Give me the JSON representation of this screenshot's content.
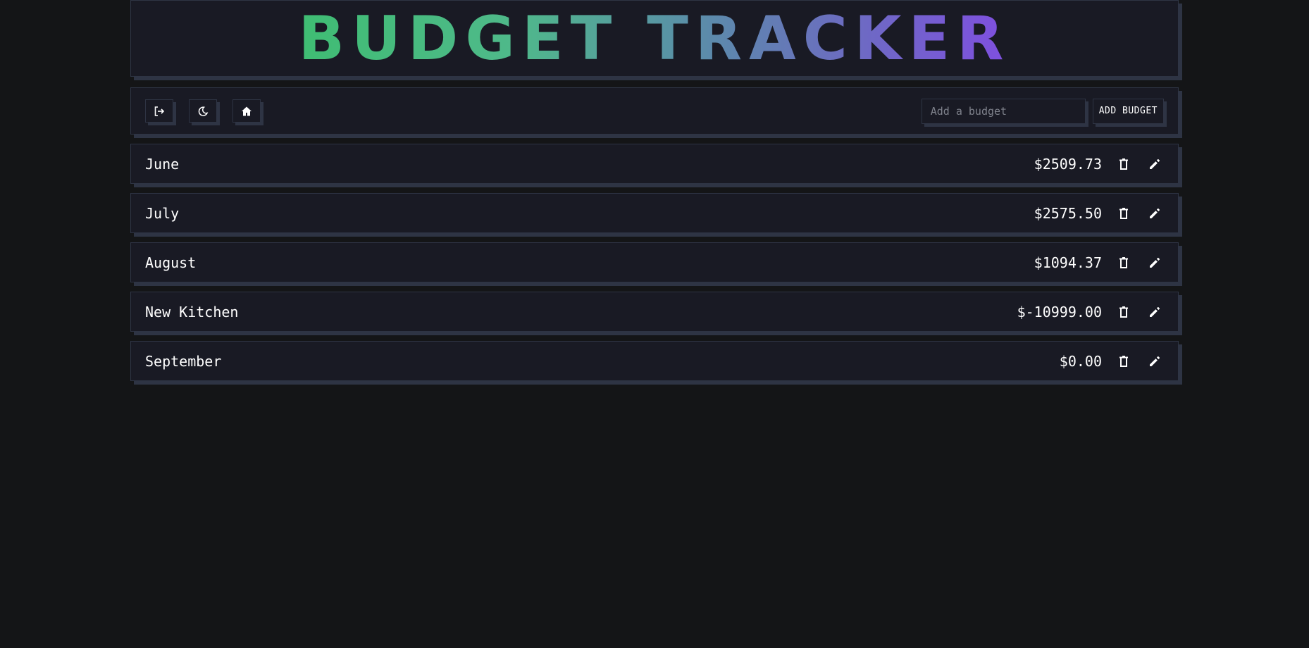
{
  "header": {
    "title": "BUDGET TRACKER"
  },
  "toolbar": {
    "buttons": [
      {
        "icon": "logout-icon"
      },
      {
        "icon": "moon-icon"
      },
      {
        "icon": "home-icon"
      }
    ],
    "add_input_placeholder": "Add a budget",
    "add_button_label": "ADD BUDGET"
  },
  "budgets": [
    {
      "name": "June",
      "amount": "$2509.73"
    },
    {
      "name": "July",
      "amount": "$2575.50"
    },
    {
      "name": "August",
      "amount": "$1094.37"
    },
    {
      "name": "New Kitchen",
      "amount": "$-10999.00"
    },
    {
      "name": "September",
      "amount": "$0.00"
    }
  ],
  "colors": {
    "background": "#141517",
    "panel": "#191a24",
    "border": "#2e3444",
    "gradient_start": "#3fbd73",
    "gradient_end": "#7f4fe0"
  }
}
